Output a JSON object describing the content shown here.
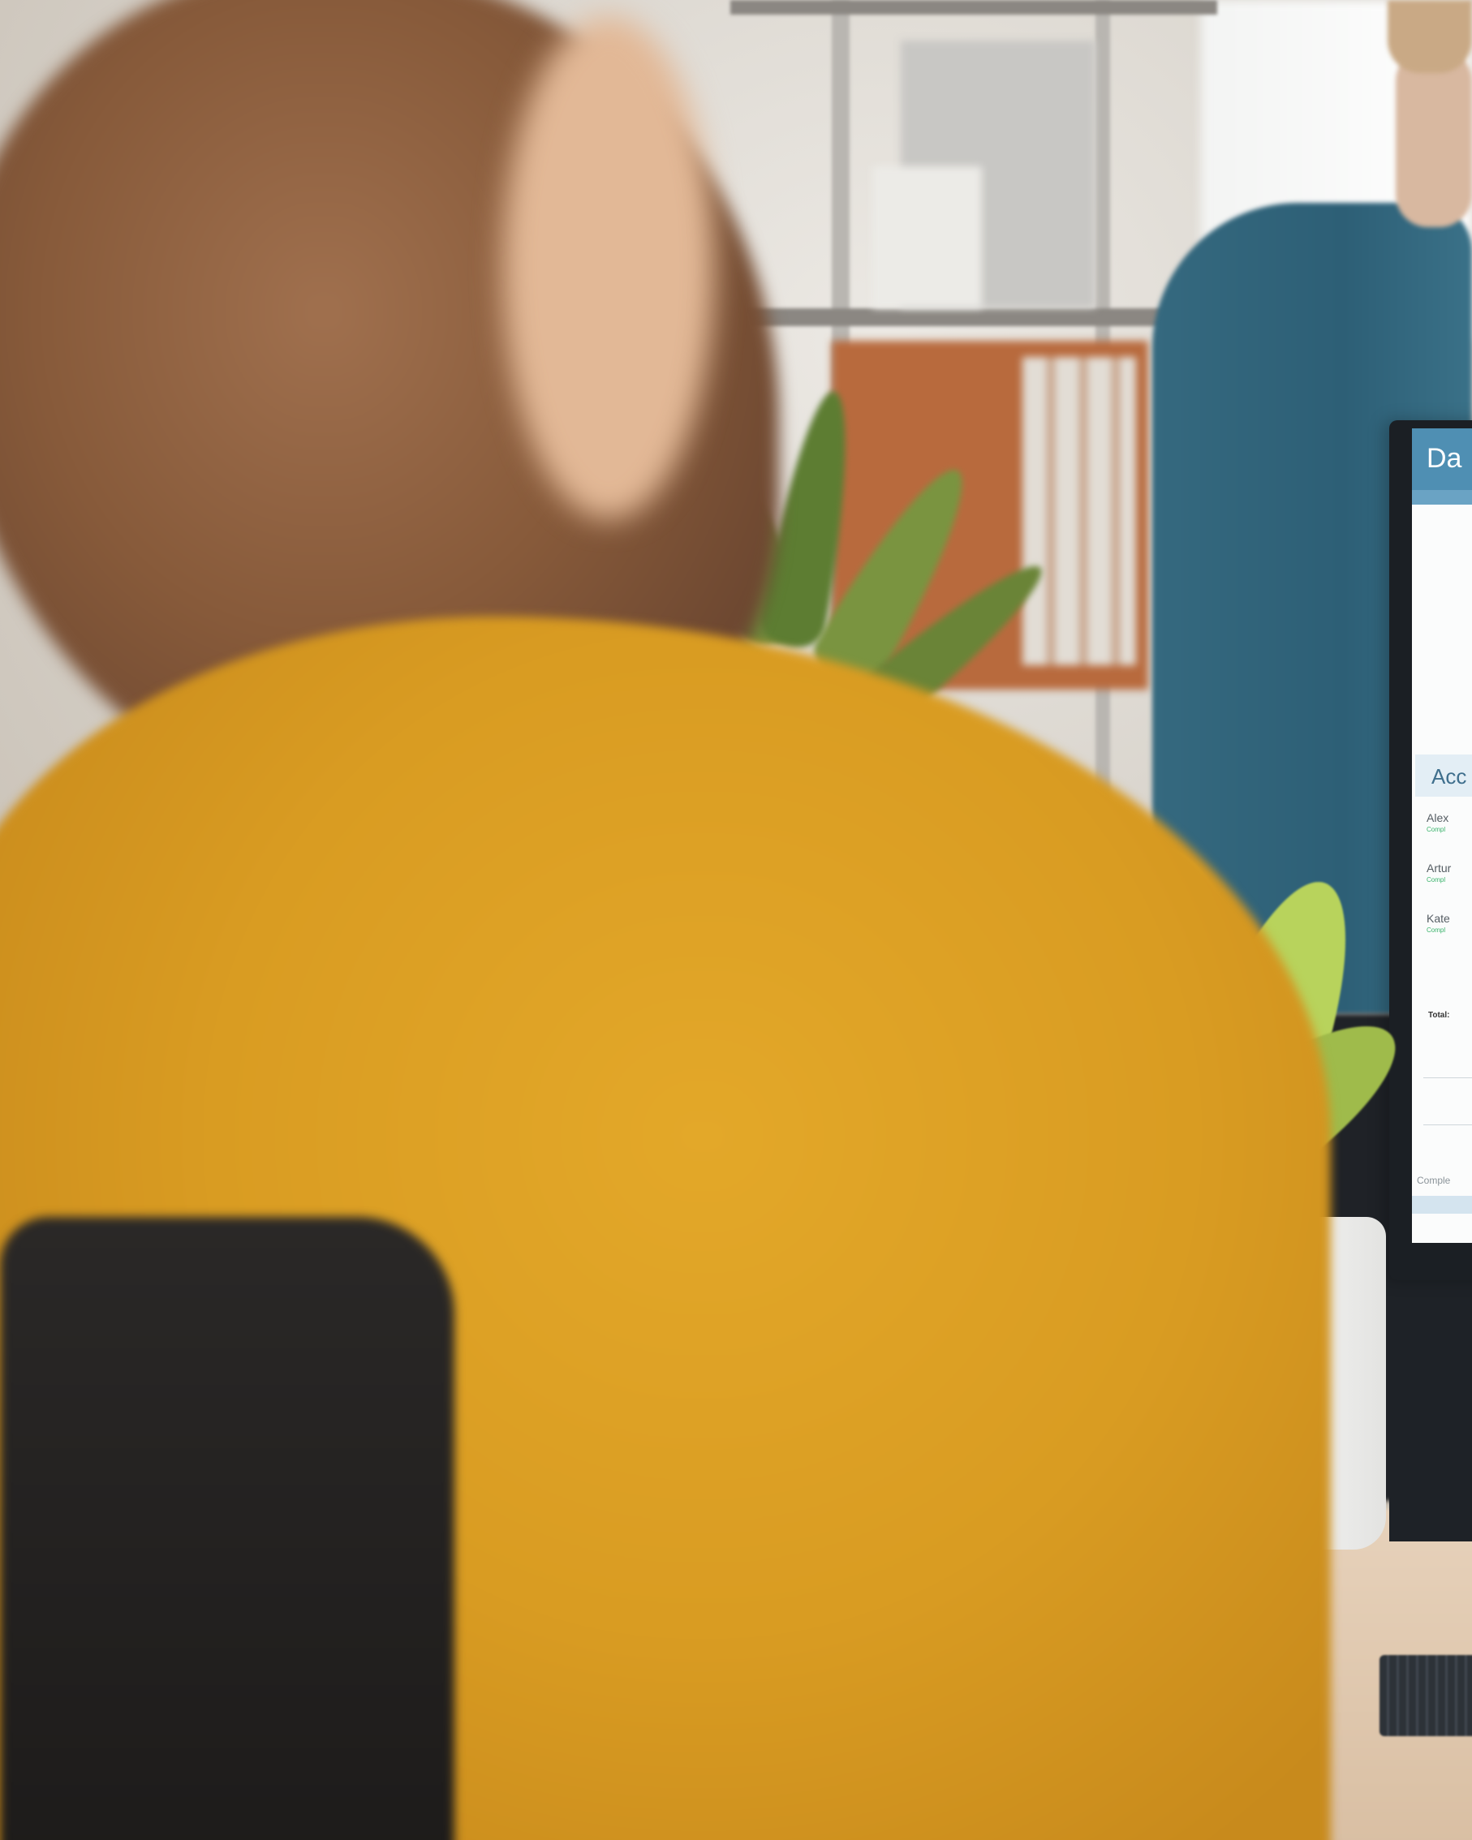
{
  "monitor": {
    "app_title": "Da",
    "panel_title": "Acc",
    "rows": [
      {
        "name": "Alex",
        "status": "Compl"
      },
      {
        "name": "Artur",
        "status": "Compl"
      },
      {
        "name": "Kate",
        "status": "Compl"
      }
    ],
    "total_label": "Total:",
    "footer_label": "Comple"
  },
  "colors": {
    "header": "#4f8fb3",
    "status_green": "#39b36a",
    "sweater": "#d89a24",
    "hair": "#8a5a3c"
  }
}
